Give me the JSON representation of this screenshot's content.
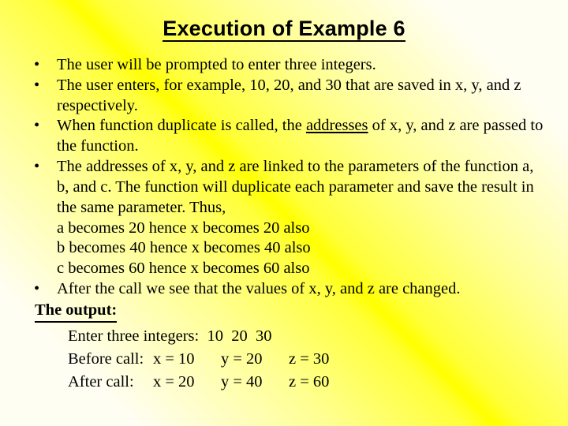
{
  "slide": {
    "title": "Execution of Example 6",
    "background": {
      "accent_yellow": "#ffff00",
      "accent_white": "#fffef2"
    },
    "bullet_glyph": "•",
    "bullets": [
      {
        "text": "The user will be prompted to enter three integers."
      },
      {
        "text": "The user enters, for example, 10, 20, and 30 that are saved in x, y, and z respectively."
      },
      {
        "pre": "When function duplicate is called, the ",
        "underlined": "addresses",
        "post": " of  x, y, and z are passed to the function."
      },
      {
        "text": "The addresses of x, y, and z are linked to the parameters of the function a, b, and c. The function will duplicate each parameter and save the result in the same parameter. Thus,"
      }
    ],
    "plain_lines": [
      "a becomes 20  hence x becomes 20 also",
      "b becomes 40  hence x becomes 40 also",
      "c becomes 60  hence x becomes 60 also"
    ],
    "final_bullet": "After the call we see that the values of x, y, and z are changed.",
    "output_heading": "The output:",
    "output_lines": [
      {
        "label": "Enter three integers:",
        "values": [
          "10  20  30"
        ]
      },
      {
        "label": "Before call:",
        "values": [
          "x = 10",
          "y = 20",
          "z = 30"
        ]
      },
      {
        "label": "After call:",
        "values": [
          "x = 20",
          "y = 40",
          "z = 60"
        ]
      }
    ],
    "output_text": {
      "line1": "Enter three integers:  10  20  30",
      "line2_label": "Before call:",
      "line2_x": "x = 10",
      "line2_y": "y = 20",
      "line2_z": "z = 30",
      "line3_label": "After call:",
      "line3_x": "x = 20",
      "line3_y": "y = 40",
      "line3_z": "z = 60"
    }
  }
}
